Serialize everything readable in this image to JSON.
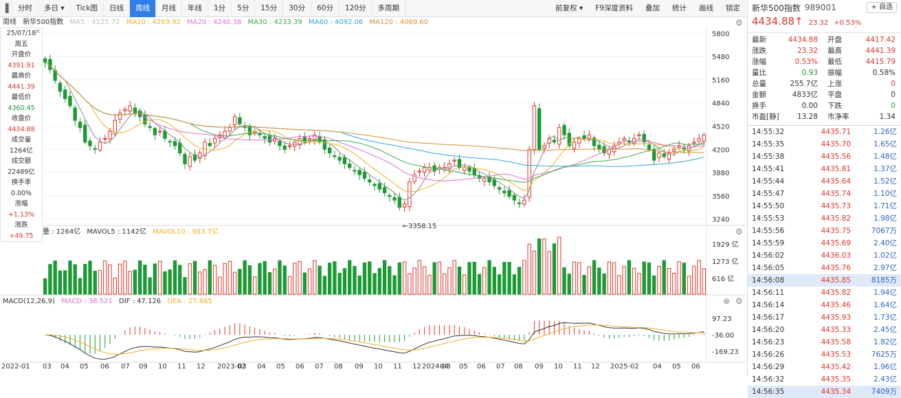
{
  "toolbar": {
    "tabs": [
      "分时",
      "多日 ▾",
      "Tick图",
      "日线",
      "周线",
      "月线",
      "年线",
      "1分",
      "5分",
      "15分",
      "30分",
      "60分",
      "120分",
      "多周期"
    ],
    "active_tab": "周线",
    "right": [
      "前复权 ▾",
      "F9深度资料",
      "叠加",
      "统计",
      "画线",
      "锁定"
    ]
  },
  "ma_legend": {
    "period": "周线",
    "name": "新华500指数",
    "ma5": "MA5 : 4125.72",
    "ma10": "MA10 : 4269.92",
    "ma20": "MA20 : 4240.38",
    "ma30": "MA30 : 4233.39",
    "ma60": "MA60 : 4092.06",
    "ma120": "MA120 : 4069.60"
  },
  "vol_legend": {
    "vol": "量 : 1264亿",
    "mavol5": "MAVOL5 : 1142亿",
    "mavol10": "MAVOL10 : 983.7亿"
  },
  "macd_legend": {
    "title": "MACD(12,26,9)",
    "macd": "MACD : 38.521",
    "dif": "DIF : 47.126",
    "dea": "DEA : 27.865"
  },
  "info_panel": {
    "date": "25/07/18",
    "weekday": "周五",
    "open_label": "开盘价",
    "open": "4391.91",
    "high_label": "最高价",
    "high": "4441.39",
    "low_label": "最低价",
    "low": "4360.45",
    "close_label": "收盘价",
    "close": "4434.88",
    "vol_label": "成交量",
    "vol": "1264亿",
    "amount_label": "成交额",
    "amount": "22489亿",
    "turnover_label": "换手率",
    "turnover": "0.00%",
    "pct_label": "涨幅",
    "pct": "+1.13%",
    "chg_label": "涨跌",
    "chg": "+49.75"
  },
  "price_axis": [
    "5800",
    "5480",
    "5160",
    "4840",
    "4520",
    "4200",
    "3880",
    "3560",
    "3240"
  ],
  "vol_axis": [
    "1929 亿",
    "1273 亿",
    "616 亿"
  ],
  "macd_axis": [
    "97.23",
    "-36.00",
    "-169.23"
  ],
  "low_marker": "←3358.15",
  "x_axis": [
    "2022-01",
    "03",
    "04",
    "05",
    "06",
    "07",
    "09",
    "10",
    "11",
    "12",
    "2023-02",
    "03",
    "04",
    "05",
    "06",
    "07",
    "08",
    "09",
    "10",
    "11",
    "12",
    "2024-03",
    "04",
    "05",
    "06",
    "07",
    "08",
    "09",
    "10",
    "11",
    "12",
    "2025-02",
    "04",
    "05",
    "06"
  ],
  "quote": {
    "name": "新华500指数",
    "code": "989001",
    "add_label": "+ 自选",
    "price": "4434.88",
    "arrow": "↑",
    "chg": "23.32",
    "pct": "+0.53%",
    "rows": [
      {
        "k1": "最新",
        "v1": "4434.88",
        "k2": "开盘",
        "v2": "4417.42",
        "c1": "red",
        "c2": "red"
      },
      {
        "k1": "涨跌",
        "v1": "23.32",
        "k2": "最高",
        "v2": "4441.39",
        "c1": "red",
        "c2": "red"
      },
      {
        "k1": "涨幅",
        "v1": "0.53%",
        "k2": "最低",
        "v2": "4415.79",
        "c1": "red",
        "c2": "red"
      },
      {
        "k1": "量比",
        "v1": "0.93",
        "k2": "振幅",
        "v2": "0.58%",
        "c1": "green",
        "c2": ""
      },
      {
        "k1": "总量",
        "v1": "255.7亿",
        "k2": "上涨",
        "v2": "0",
        "c1": "",
        "c2": "red"
      },
      {
        "k1": "金额",
        "v1": "4833亿",
        "k2": "平盘",
        "v2": "0",
        "c1": "",
        "c2": ""
      },
      {
        "k1": "换手",
        "v1": "0.00",
        "k2": "下跌",
        "v2": "0",
        "c1": "",
        "c2": "green"
      },
      {
        "k1": "市盈[静]",
        "v1": "13.28",
        "k2": "市净率",
        "v2": "1.34",
        "c1": "",
        "c2": ""
      }
    ],
    "ticks": [
      {
        "t": "14:55:32",
        "p": "4435.71",
        "v": "1.26亿"
      },
      {
        "t": "14:55:35",
        "p": "4435.70",
        "v": "1.65亿"
      },
      {
        "t": "14:55:38",
        "p": "4435.56",
        "v": "1.48亿"
      },
      {
        "t": "14:55:41",
        "p": "4435.81",
        "v": "1.37亿"
      },
      {
        "t": "14:55:44",
        "p": "4435.64",
        "v": "1.52亿"
      },
      {
        "t": "14:55:47",
        "p": "4435.74",
        "v": "1.10亿"
      },
      {
        "t": "14:55:50",
        "p": "4435.73",
        "v": "1.71亿"
      },
      {
        "t": "14:55:53",
        "p": "4435.82",
        "v": "1.98亿"
      },
      {
        "t": "14:55:56",
        "p": "4435.75",
        "v": "7067万"
      },
      {
        "t": "14:55:59",
        "p": "4435.69",
        "v": "2.40亿"
      },
      {
        "t": "14:56:02",
        "p": "4436.03",
        "v": "1.02亿"
      },
      {
        "t": "14:56:05",
        "p": "4435.76",
        "v": "2.97亿"
      },
      {
        "t": "14:56:08",
        "p": "4435.85",
        "v": "8185万"
      },
      {
        "t": "14:56:11",
        "p": "4435.82",
        "v": "1.94亿"
      },
      {
        "t": "14:56:14",
        "p": "4435.46",
        "v": "1.64亿"
      },
      {
        "t": "14:56:17",
        "p": "4435.93",
        "v": "1.73亿"
      },
      {
        "t": "14:56:20",
        "p": "4435.33",
        "v": "2.45亿"
      },
      {
        "t": "14:56:23",
        "p": "4435.58",
        "v": "1.82亿"
      },
      {
        "t": "14:56:26",
        "p": "4435.53",
        "v": "7625万"
      },
      {
        "t": "14:56:29",
        "p": "4435.42",
        "v": "1.96亿"
      },
      {
        "t": "14:56:32",
        "p": "4435.35",
        "v": "2.43亿"
      },
      {
        "t": "14:56:35",
        "p": "4435.34",
        "v": "7409万"
      }
    ]
  },
  "chart_data": {
    "type": "candlestick",
    "colors": {
      "up": "#e0342a",
      "down": "#1d9a35",
      "ma5": "#888888",
      "ma10": "#f0b020",
      "ma20": "#e070d0",
      "ma30": "#3aa84a",
      "ma60": "#2aa8d8",
      "ma120": "#d89030"
    },
    "closes": [
      5400,
      5300,
      5150,
      5000,
      4900,
      4800,
      4600,
      4500,
      4300,
      4250,
      4200,
      4300,
      4350,
      4450,
      4600,
      4700,
      4750,
      4800,
      4700,
      4650,
      4550,
      4500,
      4400,
      4450,
      4350,
      4300,
      4250,
      4150,
      4000,
      4100,
      4050,
      4150,
      4300,
      4250,
      4350,
      4400,
      4450,
      4500,
      4650,
      4550,
      4500,
      4400,
      4450,
      4400,
      4350,
      4300,
      4350,
      4250,
      4200,
      4250,
      4300,
      4350,
      4300,
      4350,
      4400,
      4300,
      4200,
      4150,
      4100,
      4050,
      4000,
      3950,
      3900,
      3850,
      3800,
      3750,
      3700,
      3650,
      3600,
      3550,
      3500,
      3400,
      3450,
      3750,
      3850,
      3900,
      3950,
      3950,
      3900,
      3950,
      3950,
      4000,
      4050,
      3950,
      3950,
      3900,
      3850,
      3800,
      3800,
      3750,
      3700,
      3650,
      3600,
      3550,
      3500,
      3450,
      3500,
      4200,
      4800,
      4200,
      4250,
      4350,
      4300,
      4500,
      4400,
      4250,
      4300,
      4350,
      4350,
      4400,
      4250,
      4200,
      4150,
      4200,
      4250,
      4300,
      4350,
      4300,
      4350,
      4400,
      4300,
      4200,
      4050,
      4150,
      4100,
      4150,
      4200,
      4250,
      4200,
      4250,
      4300,
      4350,
      4400
    ],
    "price_range": [
      3160,
      5880
    ],
    "low_point": 3358.15,
    "last_close": 4434.88
  }
}
